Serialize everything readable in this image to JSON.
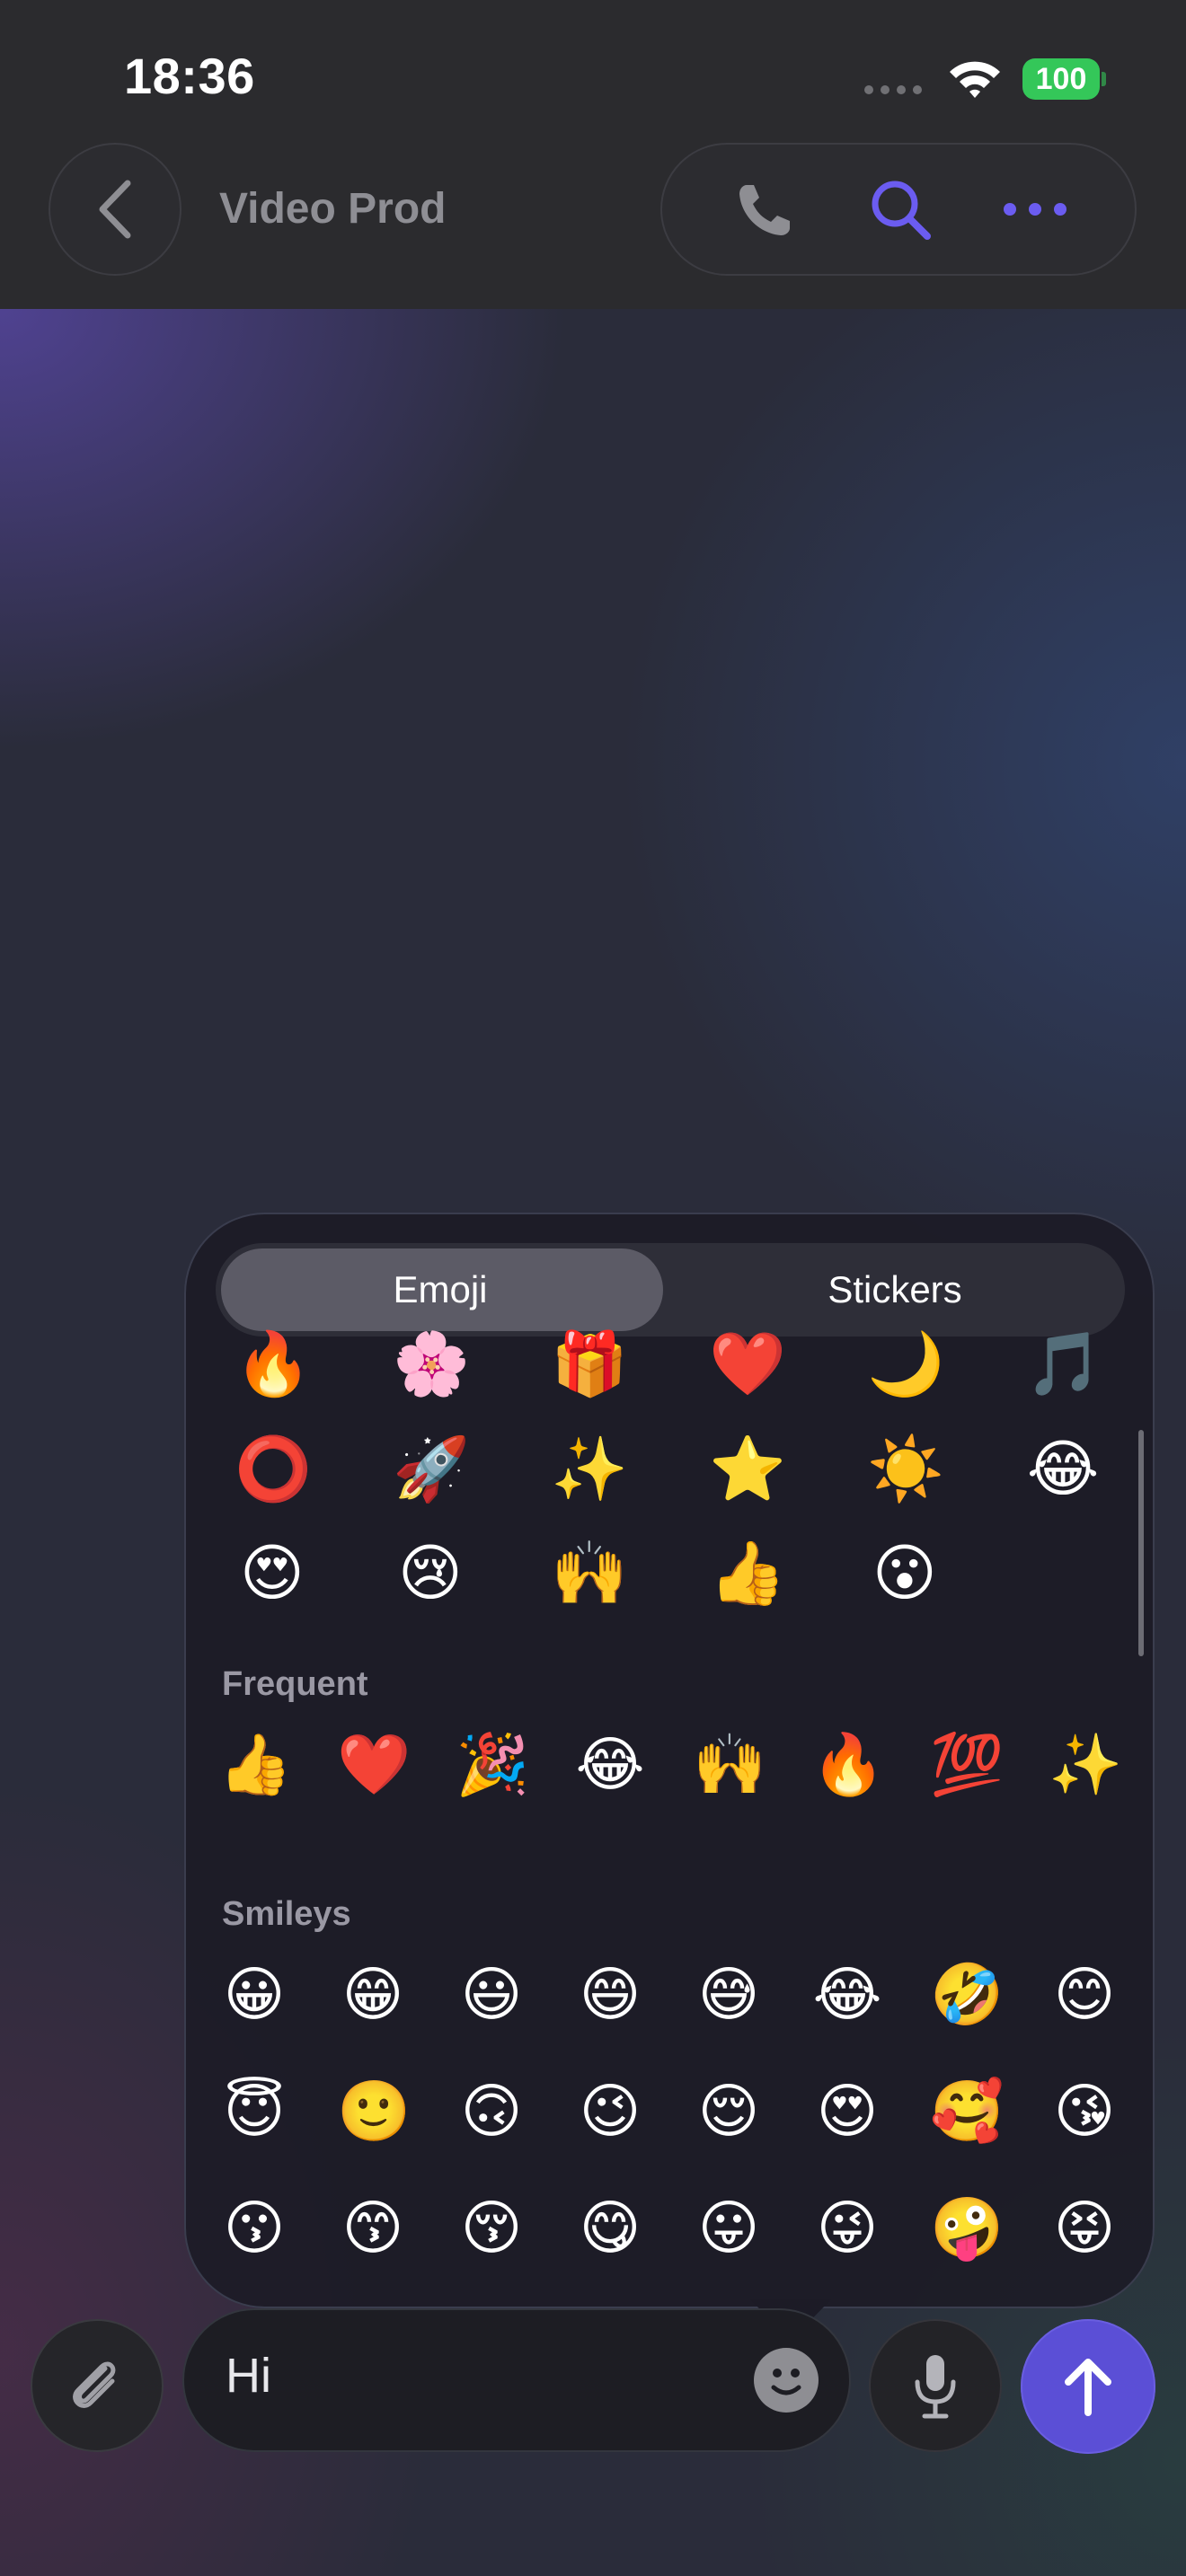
{
  "status": {
    "time": "18:36",
    "battery": "100",
    "battery_color": "#34c759"
  },
  "header": {
    "title": "Video Prod",
    "back_icon": "chevron-left-icon",
    "actions": [
      "phone-icon",
      "search-icon",
      "more-icon"
    ],
    "accent": "#6b5cf0"
  },
  "picker": {
    "tabs": [
      {
        "label": "Emoji",
        "active": true
      },
      {
        "label": "Stickers",
        "active": false
      }
    ],
    "top_rows": [
      [
        "🔥",
        "🌸",
        "🎁",
        "❤️",
        "🌙",
        "🎵"
      ],
      [
        "⭕",
        "🚀",
        "✨",
        "⭐",
        "☀️",
        "😂"
      ],
      [
        "😍",
        "😢",
        "🙌",
        "👍",
        "😮"
      ]
    ],
    "sections": [
      {
        "title": "Frequent",
        "rows": [
          [
            "👍",
            "❤️",
            "🎉",
            "😂",
            "🙌",
            "🔥",
            "💯",
            "✨"
          ]
        ]
      },
      {
        "title": "Smileys",
        "rows": [
          [
            "😀",
            "😁",
            "😃",
            "😄",
            "😅",
            "😂",
            "🤣",
            "😊"
          ],
          [
            "😇",
            "🙂",
            "🙃",
            "😉",
            "😌",
            "😍",
            "🥰",
            "😘"
          ],
          [
            "😗",
            "😙",
            "😚",
            "😋",
            "😛",
            "😜",
            "🤪",
            "😝"
          ]
        ]
      }
    ]
  },
  "composer": {
    "value": "Hi",
    "attach_icon": "paperclip-icon",
    "emoji_icon": "smiley-icon",
    "mic_icon": "microphone-icon",
    "send_icon": "arrow-up-icon",
    "send_color": "#5b4fd6"
  }
}
